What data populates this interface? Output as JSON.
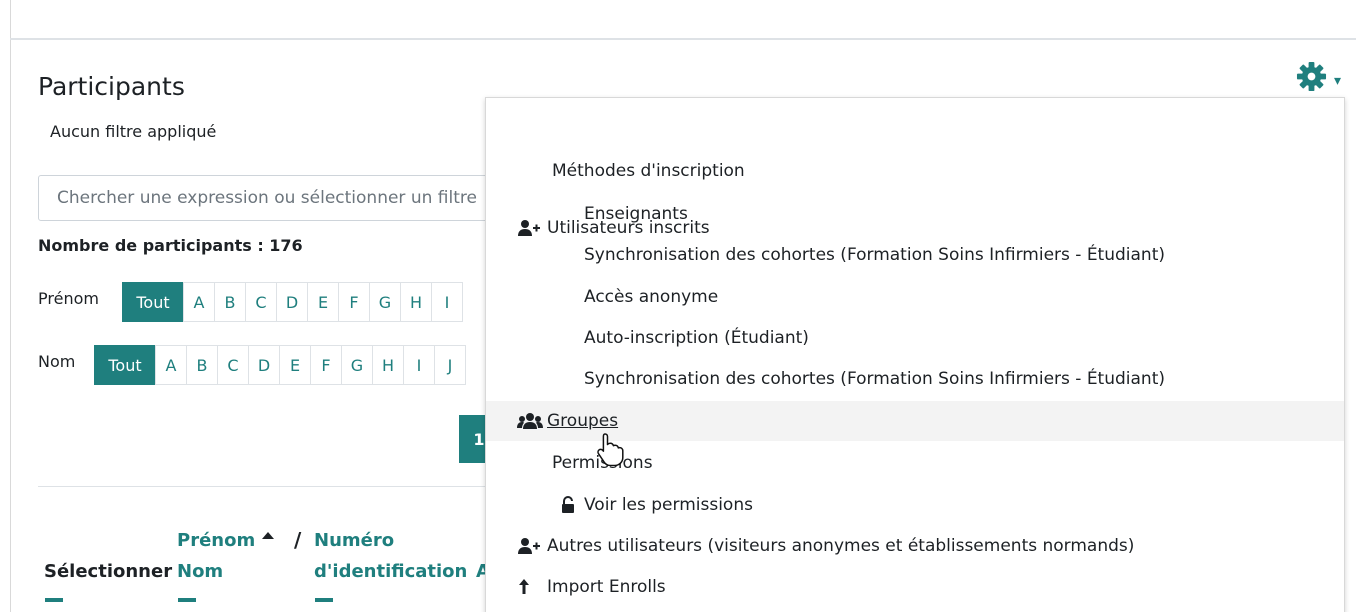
{
  "page": {
    "title": "Participants",
    "filter_state": "Aucun filtre appliqué",
    "search_placeholder": "Chercher une expression ou sélectionner un filtre",
    "participant_count": "Nombre de participants : 176"
  },
  "first_name_filter": {
    "label": "Prénom",
    "letters": [
      "Tout",
      "A",
      "B",
      "C",
      "D",
      "E",
      "F",
      "G",
      "H",
      "I"
    ]
  },
  "last_name_filter": {
    "label": "Nom",
    "letters": [
      "Tout",
      "A",
      "B",
      "C",
      "D",
      "E",
      "F",
      "G",
      "H",
      "I",
      "J"
    ]
  },
  "pagination": {
    "current_page": "1"
  },
  "table_headers": {
    "select": "Sélectionner",
    "first_name": "Prénom",
    "last_name": "Nom",
    "separator": "/",
    "id_line1": "Numéro",
    "id_line2": "d'identification",
    "next_col_fragment": "A"
  },
  "actions_menu": {
    "items": [
      {
        "label": "Utilisateurs inscrits",
        "icon": "user-plus-icon",
        "level": 0
      },
      {
        "label": "Méthodes d'inscription",
        "icon": "",
        "level": 1
      },
      {
        "label": "Enseignants",
        "icon": "",
        "level": 2
      },
      {
        "label": "Synchronisation des cohortes (Formation Soins Infirmiers  - Étudiant)",
        "icon": "",
        "level": 2
      },
      {
        "label": "Accès anonyme",
        "icon": "",
        "level": 2
      },
      {
        "label": "Auto-inscription (Étudiant)",
        "icon": "",
        "level": 2
      },
      {
        "label": "Synchronisation des cohortes (Formation Soins Infirmiers  - Étudiant)",
        "icon": "",
        "level": 2
      },
      {
        "label": "Groupes",
        "icon": "users-icon",
        "level": 0,
        "hover": true
      },
      {
        "label": "Permissions",
        "icon": "",
        "level": 1
      },
      {
        "label": "Voir les permissions",
        "icon": "unlock-icon",
        "level": 1
      },
      {
        "label": "Autres utilisateurs (visiteurs anonymes et établissements normands)",
        "icon": "user-plus-icon",
        "level": 0
      },
      {
        "label": "Import Enrolls",
        "icon": "upload-arrow-icon",
        "level": 0
      }
    ]
  },
  "colors": {
    "teal": "#1f7f7e",
    "text": "#1d2125",
    "border": "#dee2e6"
  }
}
